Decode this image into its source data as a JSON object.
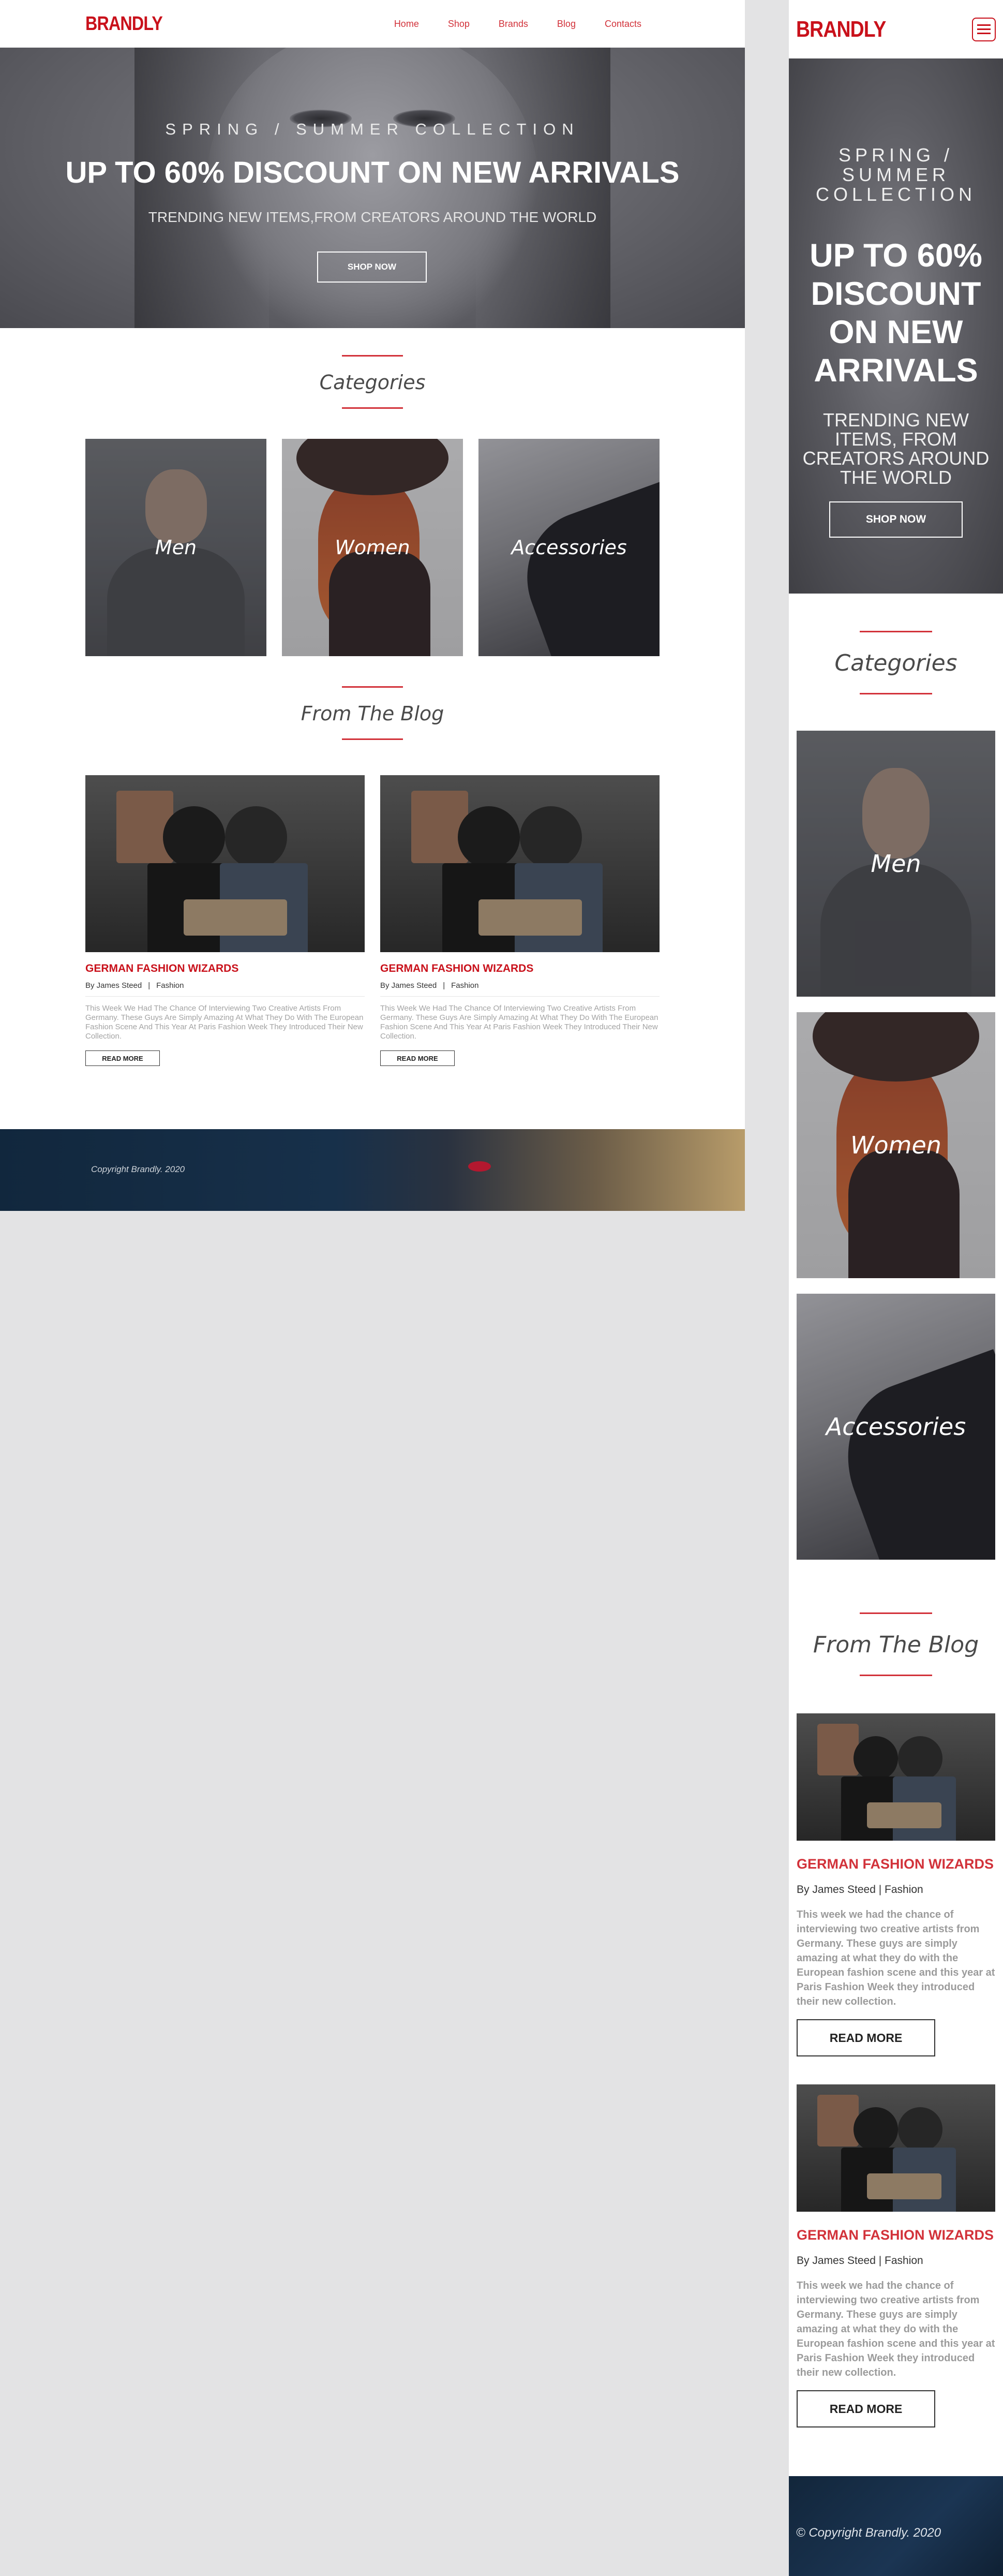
{
  "brand": "BRANDLY",
  "nav": [
    "Home",
    "Shop",
    "Brands",
    "Blog",
    "Contacts"
  ],
  "hero": {
    "subtitle": "SPRING / SUMMER COLLECTION",
    "title": "UP TO 60% DISCOUNT ON NEW ARRIVALS",
    "tagline": "TRENDING NEW ITEMS,FROM CREATORS AROUND THE WORLD",
    "button": "SHOP NOW"
  },
  "categories": {
    "heading": "Categories",
    "items": [
      "Men",
      "Women",
      "Accessories"
    ]
  },
  "blog": {
    "heading": "From The Blog",
    "posts": [
      {
        "title": "GERMAN FASHION WIZARDS",
        "author": "By James Steed",
        "category": "Fashion",
        "excerpt": "This Week We Had The Chance Of Interviewing Two Creative Artists From Germany. These Guys Are Simply Amazing At What They Do With The    European Fashion Scene And This Year At Paris Fashion Week They    Introduced Their New Collection.",
        "button": "READ MORE"
      },
      {
        "title": "GERMAN FASHION WIZARDS",
        "author": "By James Steed",
        "category": "Fashion",
        "excerpt": "This Week We Had The Chance Of Interviewing Two Creative Artists From Germany. These Guys Are Simply Amazing At What They Do With The    European Fashion Scene And This Year At Paris Fashion Week They    Introduced Their New Collection.",
        "button": "READ MORE"
      }
    ]
  },
  "footer": {
    "copyright": "Copyright Brandly. 2020"
  },
  "mobile": {
    "hero_tagline": "TRENDING NEW ITEMS, FROM CREATORS AROUND THE WORLD",
    "post_meta": "By James Steed | Fashion",
    "post_excerpt": "This week we had the chance of interviewing two creative artists from Germany. These guys are simply amazing at what they do with the European fashion scene and this year at Paris Fashion Week they introduced their new collection.",
    "footer_copyright": "© Copyright Brandly. 2020"
  },
  "colors": {
    "accent": "#c9111b",
    "accent_light": "#d2323a",
    "page_bg": "#e3e3e4",
    "footer_bg": "#12263b"
  }
}
